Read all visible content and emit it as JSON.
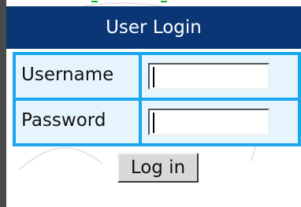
{
  "panel": {
    "title": "User Login"
  },
  "form": {
    "username_label": "Username",
    "password_label": "Password",
    "username_value": "",
    "password_value": "",
    "login_label": "Log in"
  },
  "colors": {
    "title_bg": "#0a3675",
    "table_border": "#1aa7ee",
    "cell_bg": "#e6f5fd",
    "button_bg": "#d8d8d8"
  }
}
